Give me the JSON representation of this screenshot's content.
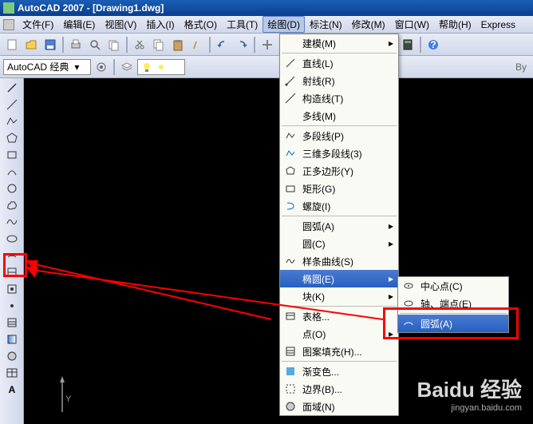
{
  "titlebar": {
    "title": "AutoCAD 2007 - [Drawing1.dwg]"
  },
  "menubar": {
    "items": [
      "文件(F)",
      "编辑(E)",
      "视图(V)",
      "插入(I)",
      "格式(O)",
      "工具(T)",
      "绘图(D)",
      "标注(N)",
      "修改(M)",
      "窗口(W)",
      "帮助(H)",
      "Express"
    ]
  },
  "toolbar2": {
    "combo_label": "AutoCAD 经典",
    "bylayer": "By"
  },
  "dropdown": {
    "items": [
      {
        "label": "建模(M)",
        "arrow": true
      },
      {
        "label": "直线(L)"
      },
      {
        "label": "射线(R)"
      },
      {
        "label": "构造线(T)"
      },
      {
        "label": "多线(M)"
      },
      {
        "label": "多段线(P)"
      },
      {
        "label": "三维多段线(3)"
      },
      {
        "label": "正多边形(Y)"
      },
      {
        "label": "矩形(G)"
      },
      {
        "label": "螺旋(I)"
      },
      {
        "label": "圆弧(A)",
        "arrow": true
      },
      {
        "label": "圆(C)",
        "arrow": true
      },
      {
        "label": "样条曲线(S)"
      },
      {
        "label": "椭圆(E)",
        "arrow": true,
        "hover": true
      },
      {
        "label": "块(K)",
        "arrow": true
      },
      {
        "label": "表格..."
      },
      {
        "label": "点(O)",
        "arrow": true
      },
      {
        "label": "图案填充(H)..."
      },
      {
        "label": "渐变色..."
      },
      {
        "label": "边界(B)..."
      },
      {
        "label": "面域(N)"
      }
    ]
  },
  "submenu": {
    "items": [
      {
        "label": "中心点(C)"
      },
      {
        "label": "轴、端点(E)"
      },
      {
        "label": "圆弧(A)",
        "hover": true
      }
    ]
  },
  "ucs": {
    "y": "Y"
  },
  "watermark": {
    "logo": "Baidu 经验",
    "url": "jingyan.baidu.com"
  }
}
